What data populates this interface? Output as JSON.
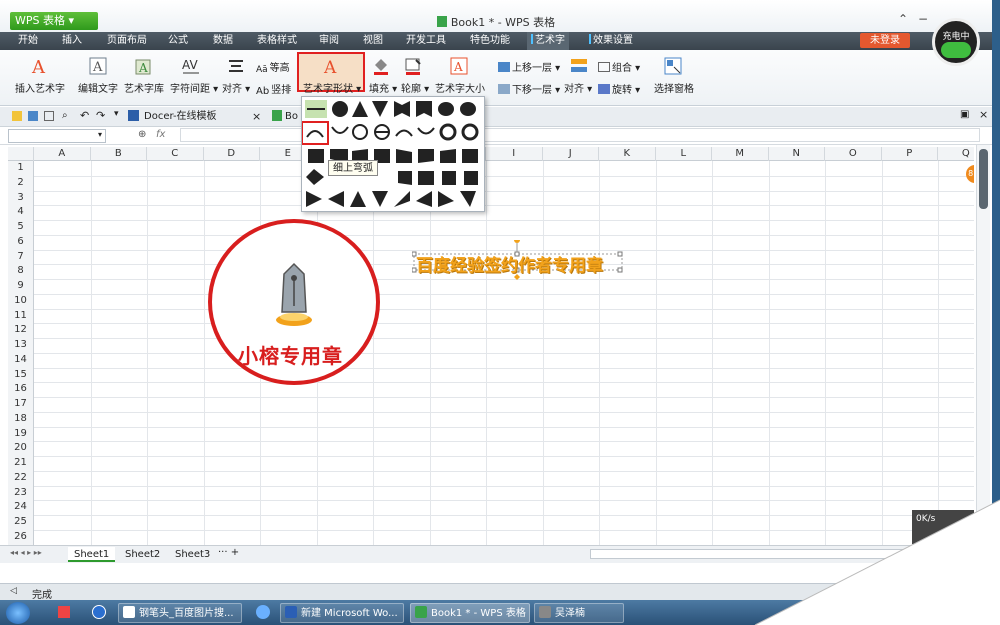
{
  "app": {
    "menu_button": "WPS 表格",
    "title": "Book1 * - WPS 表格",
    "login": "未登录",
    "charging": "充电中"
  },
  "menu_tabs": [
    "开始",
    "插入",
    "页面布局",
    "公式",
    "数据",
    "表格样式",
    "审阅",
    "视图",
    "开发工具",
    "特色功能",
    "艺术字",
    "效果设置"
  ],
  "active_tab": "艺术字",
  "ribbon": {
    "insert_art": "插入艺术字",
    "edit_text": "编辑文字",
    "art_gallery": "艺术字库",
    "char_spacing": "字符间距",
    "align": "对齐",
    "equal_height": "等高",
    "vertical": "竖排",
    "art_shape": "艺术字形状",
    "fill": "填充",
    "outline": "轮廓",
    "art_size": "艺术字大小",
    "bring_forward": "上移一层",
    "send_backward": "下移一层",
    "align2": "对齐",
    "group": "组合",
    "rotate": "旋转",
    "selection_pane": "选择窗格"
  },
  "doc_tabs": [
    "Docer-在线模板",
    "Bo"
  ],
  "formula": {
    "fx": "fx"
  },
  "columns": [
    "A",
    "B",
    "C",
    "D",
    "E",
    "F",
    "G",
    "H",
    "I",
    "J",
    "K",
    "L",
    "M",
    "N",
    "O",
    "P",
    "Q"
  ],
  "rows": [
    "1",
    "2",
    "3",
    "4",
    "5",
    "6",
    "7",
    "8",
    "9",
    "10",
    "11",
    "12",
    "13",
    "14",
    "15",
    "16",
    "17",
    "18",
    "19",
    "20",
    "21",
    "22",
    "23",
    "24",
    "25",
    "26"
  ],
  "shape_tooltip": "细上弯弧",
  "seal_text": "小榕专用章",
  "wordart_text": "百度经验签约作者专用章",
  "sheets": [
    "Sheet1",
    "Sheet2",
    "Sheet3"
  ],
  "status": "完成",
  "percent_badge": "81%",
  "net_speed": "0K/s",
  "taskbar_items": [
    "钢笔头_百度图片搜...",
    "新建 Microsoft Wo...",
    "Book1 * - WPS 表格",
    "吴泽楠"
  ],
  "colors": {
    "accent_red": "#e02020",
    "wps_green": "#2f9a1c",
    "wordart_orange": "#f2a21b"
  }
}
